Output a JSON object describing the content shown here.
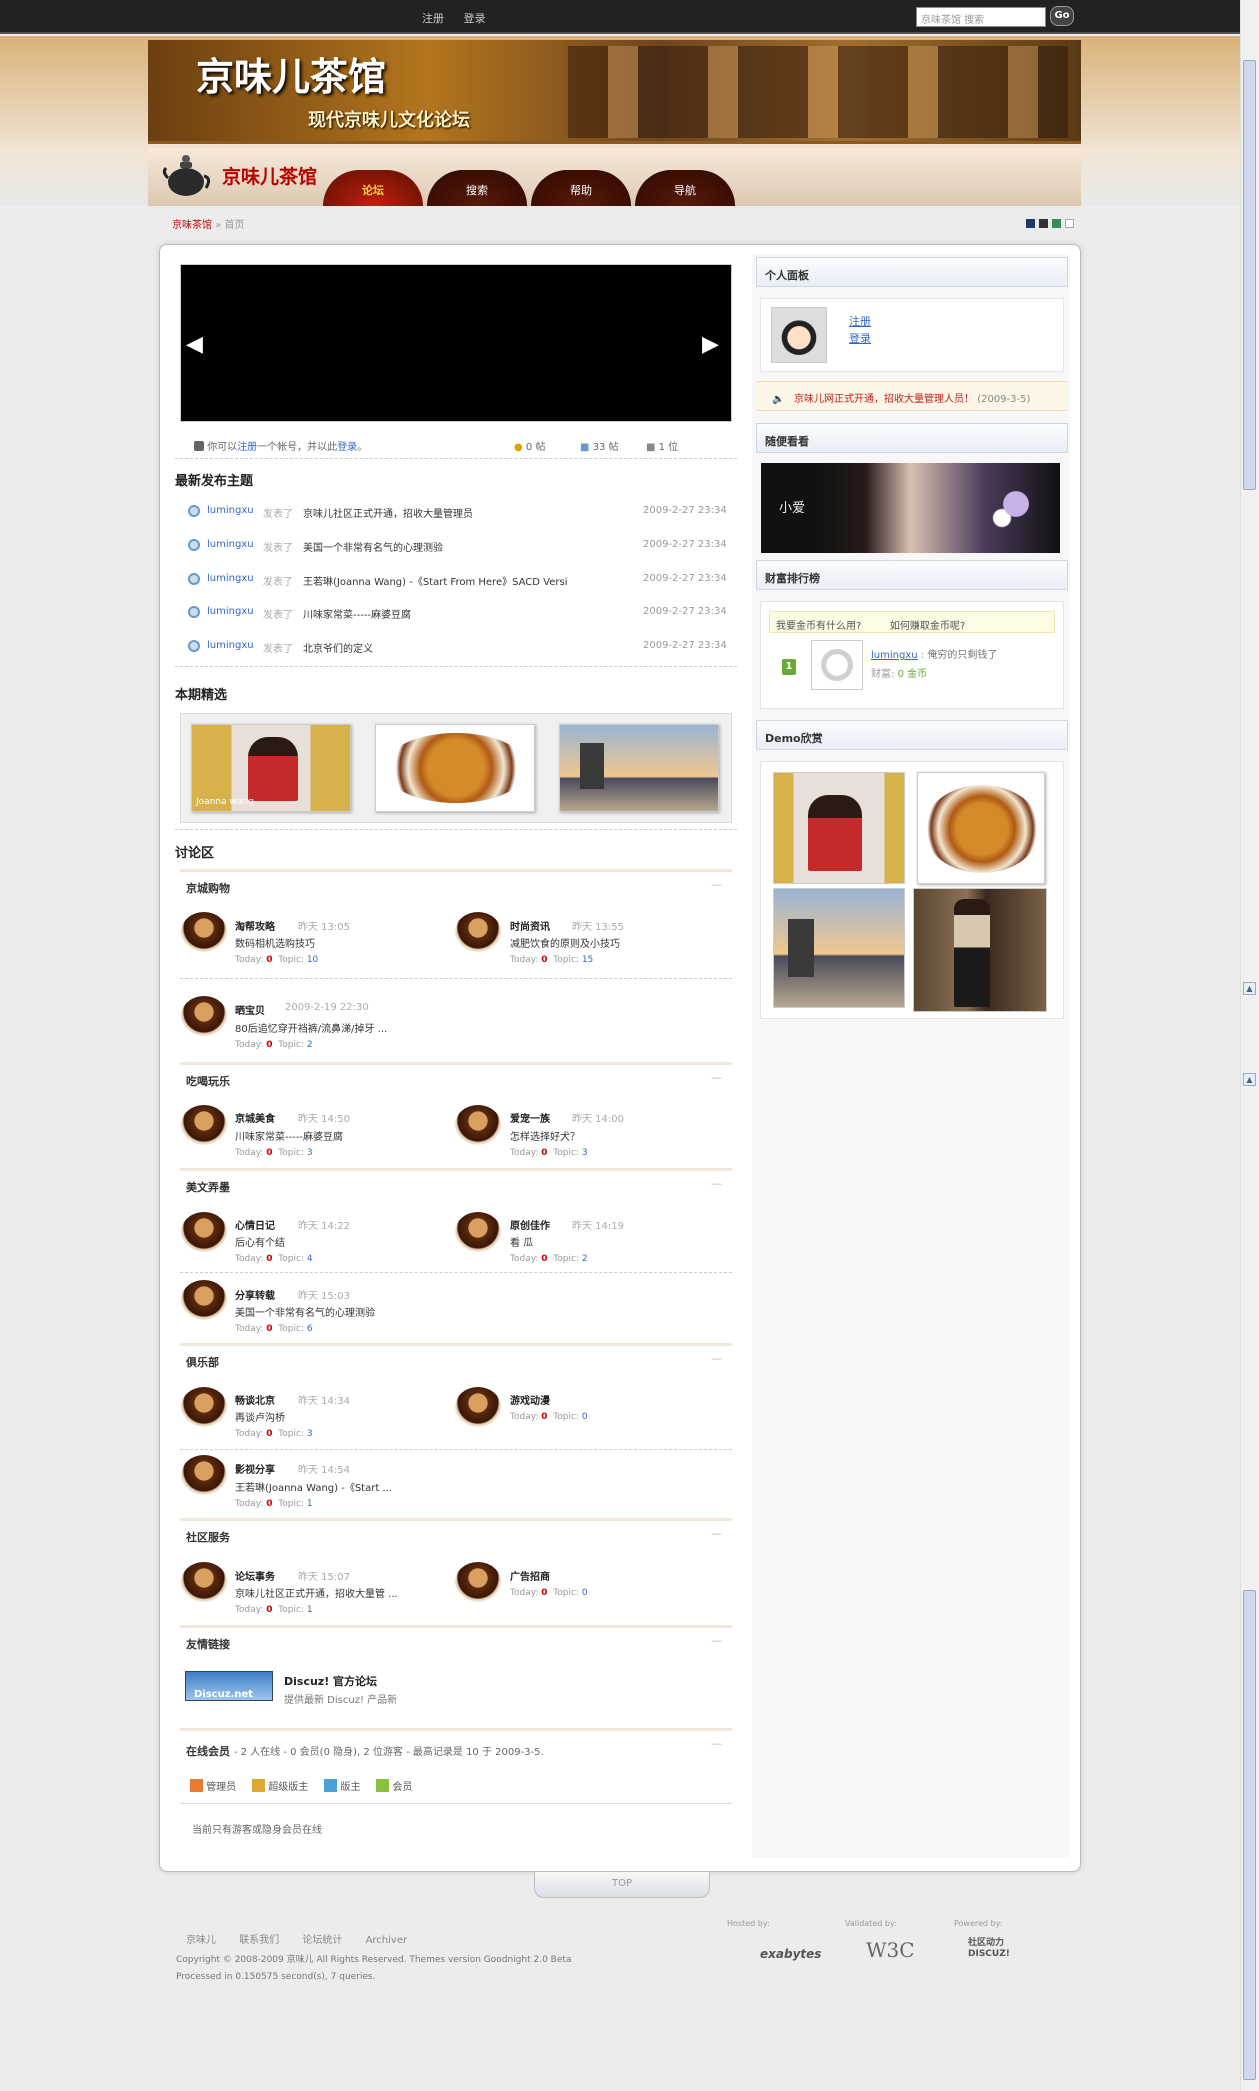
{
  "topbar": {
    "register": "注册",
    "login": "登录",
    "search_placeholder": "京味茶馆 搜索",
    "go": "Go"
  },
  "banner": {
    "title": "京味儿茶馆",
    "subtitle": "现代京味儿文化论坛"
  },
  "logo": "京味儿茶馆",
  "nav": [
    "论坛",
    "搜索",
    "帮助",
    "导航"
  ],
  "breadcrumb": {
    "home": "京味茶馆",
    "sep": "»",
    "current": "首页"
  },
  "swatches": [
    "#1d3a66",
    "#333333",
    "#3a8a5a",
    "#ffffff"
  ],
  "stats": {
    "prefix": "你可以",
    "register": "注册",
    "mid": "一个帐号，并以此",
    "login": "登录",
    "suffix": "。",
    "posts": "0 帖",
    "topics": "33 帖",
    "members": "1 位"
  },
  "latest": {
    "title": "最新发布主题",
    "items": [
      {
        "user": "lumingxu",
        "verb": "发表了",
        "title": "京味儿社区正式开通，招收大量管理员",
        "time": "2009-2-27 23:34"
      },
      {
        "user": "lumingxu",
        "verb": "发表了",
        "title": "美国一个非常有名气的心理测验",
        "time": "2009-2-27 23:34"
      },
      {
        "user": "lumingxu",
        "verb": "发表了",
        "title": "王若琳(Joanna Wang) -《Start From Here》SACD Versi",
        "time": "2009-2-27 23:34"
      },
      {
        "user": "lumingxu",
        "verb": "发表了",
        "title": "川味家常菜-----麻婆豆腐",
        "time": "2009-2-27 23:34"
      },
      {
        "user": "lumingxu",
        "verb": "发表了",
        "title": "北京爷们的定义",
        "time": "2009-2-27 23:34"
      }
    ]
  },
  "picks_title": "本期精选",
  "forum_title": "讨论区",
  "categories": [
    {
      "name": "京城购物",
      "min": "—"
    },
    {
      "name": "吃喝玩乐",
      "min": "—"
    },
    {
      "name": "美文弄墨",
      "min": "—"
    },
    {
      "name": "俱乐部",
      "min": "—"
    },
    {
      "name": "社区服务",
      "min": "—"
    },
    {
      "name": "友情链接",
      "min": "—"
    }
  ],
  "forums": [
    {
      "name": "淘帮攻略",
      "time": "昨天 13:05",
      "desc": "数码相机选购技巧",
      "today": "0",
      "topic": "10"
    },
    {
      "name": "时尚资讯",
      "time": "昨天 13:55",
      "desc": "减肥饮食的原则及小技巧",
      "today": "0",
      "topic": "15"
    },
    {
      "name": "晒宝贝",
      "time": "2009-2-19 22:30",
      "desc": "80后追忆穿开裆裤/流鼻涕/掉牙 ...",
      "today": "0",
      "topic": "2"
    },
    {
      "name": "京城美食",
      "time": "昨天 14:50",
      "desc": "川味家常菜-----麻婆豆腐",
      "today": "0",
      "topic": "3"
    },
    {
      "name": "爱宠一族",
      "time": "昨天 14:00",
      "desc": "怎样选择好犬？",
      "today": "0",
      "topic": "3"
    },
    {
      "name": "心情日记",
      "time": "昨天 14:22",
      "desc": "后心有个结",
      "today": "0",
      "topic": "4"
    },
    {
      "name": "原创佳作",
      "time": "昨天 14:19",
      "desc": "看 瓜",
      "today": "0",
      "topic": "2"
    },
    {
      "name": "分享转载",
      "time": "昨天 15:03",
      "desc": "美国一个非常有名气的心理测验",
      "today": "0",
      "topic": "6"
    },
    {
      "name": "畅谈北京",
      "time": "昨天 14:34",
      "desc": "再谈卢沟桥",
      "today": "0",
      "topic": "3"
    },
    {
      "name": "游戏动漫",
      "time": "",
      "desc": "",
      "today": "0",
      "topic": "0"
    },
    {
      "name": "影视分享",
      "time": "昨天 14:54",
      "desc": "王若琳(Joanna Wang) -《Start ...",
      "today": "0",
      "topic": "1"
    },
    {
      "name": "论坛事务",
      "time": "昨天 15:07",
      "desc": "京味儿社区正式开通，招收大量管 ...",
      "today": "0",
      "topic": "1"
    },
    {
      "name": "广告招商",
      "time": "",
      "desc": "",
      "today": "0",
      "topic": "0"
    }
  ],
  "stat_labels": {
    "today": "Today:",
    "topic": "Topic:"
  },
  "link": {
    "logo": "Discuz.net",
    "name": "Discuz! 官方论坛",
    "desc": "提供最新 Discuz! 产品新"
  },
  "online": {
    "title": "在线会员",
    "summary": "- 2 人在线 - 0 会员(0 隐身), 2 位游客 - 最高记录是 10 于 2009-3-5.",
    "legend": [
      "管理员",
      "超级版主",
      "版主",
      "会员"
    ],
    "note": "当前只有游客或隐身会员在线"
  },
  "sidebar": {
    "panel_title": "个人面板",
    "register": "注册",
    "login": "登录",
    "notice": "京味儿网正式开通，招收大量管理人员！",
    "notice_date": "(2009-3-5)",
    "random_title": "随便看看",
    "random_caption": "小爱",
    "rank_title": "财富排行榜",
    "rank_q1": "我要金币有什么用?",
    "rank_q2": "如何赚取金币呢?",
    "rank_pos": "1",
    "rank_user": "lumingxu",
    "rank_sep": ":",
    "rank_motto": "俺穷的只剩钱了",
    "rank_label": "财富:",
    "rank_value": "0 金币",
    "demo_title": "Demo欣赏"
  },
  "top_label": "TOP",
  "footer": {
    "links": [
      "京味儿",
      "联系我们",
      "论坛统计",
      "Archiver"
    ],
    "copyright": "Copyright © 2008-2009 京味儿 All Rights Reserved. Themes version Goodnight 2.0 Beta",
    "processed": "Processed in 0.150575 second(s), 7 queries.",
    "hosted": "Hosted by:",
    "hosted_name": "exabytes",
    "validated": "Validated by:",
    "validated_name": "W3C",
    "powered": "Powered by:",
    "powered_name": "社区动力 DISCUZ!"
  },
  "slider_text": "Joanna wang"
}
